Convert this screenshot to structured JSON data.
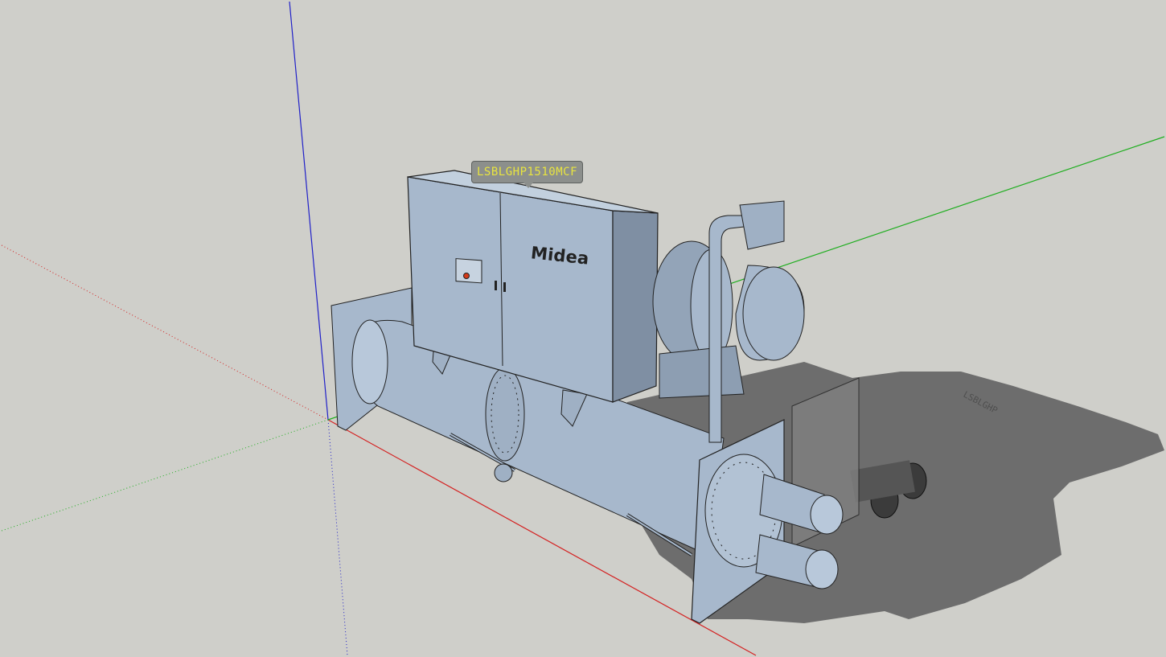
{
  "viewport": {
    "background": "#cfcfca",
    "axis_colors": {
      "red": "#d42020",
      "green": "#1fae1f",
      "blue": "#2020c8"
    },
    "model_color": "#a7b8cc",
    "shadow_color": "#6d6d6d"
  },
  "model": {
    "label": "LSBLGHP1510MCF",
    "brand": "Midea",
    "shadow_text": "LSBLGHP"
  }
}
